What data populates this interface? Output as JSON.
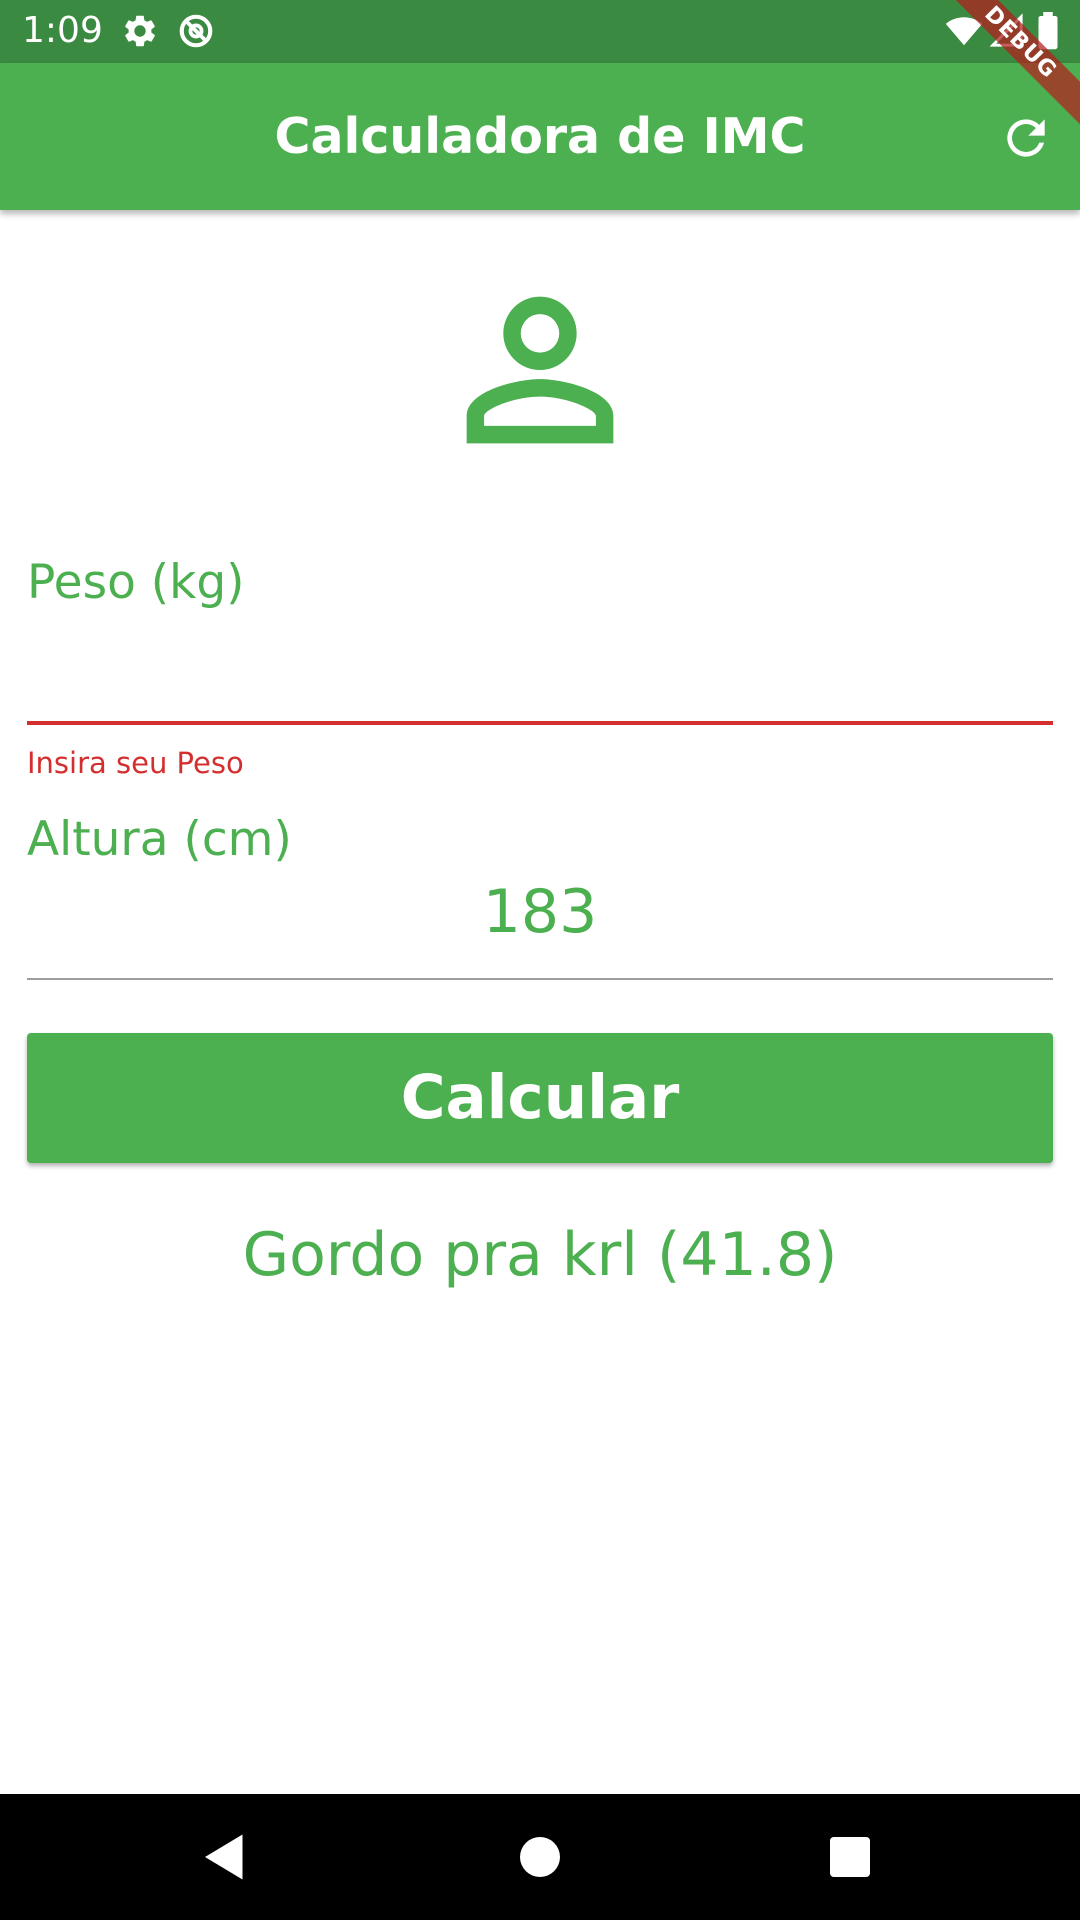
{
  "status_bar": {
    "time": "1:09",
    "icons": [
      "gear-icon",
      "at-sign-icon",
      "wifi-icon",
      "signal-icon",
      "battery-icon"
    ]
  },
  "debug_banner": {
    "label": "DEBUG"
  },
  "app_bar": {
    "title": "Calculadora de IMC",
    "action_icon": "refresh-icon"
  },
  "main": {
    "avatar_icon": "person-outline-icon",
    "weight": {
      "label": "Peso (kg)",
      "value": "",
      "error": "Insira seu Peso"
    },
    "height": {
      "label": "Altura (cm)",
      "value": "183"
    },
    "calculate_button": {
      "label": "Calcular"
    },
    "result": "Gordo pra krl (41.8)"
  },
  "nav_bar": {
    "icons": [
      "back-icon",
      "home-icon",
      "recents-icon"
    ]
  },
  "colors": {
    "primary": "#4caf50",
    "status_bar": "#3b8a41",
    "error": "#d32f2f",
    "underline": "#9e9e9e"
  }
}
